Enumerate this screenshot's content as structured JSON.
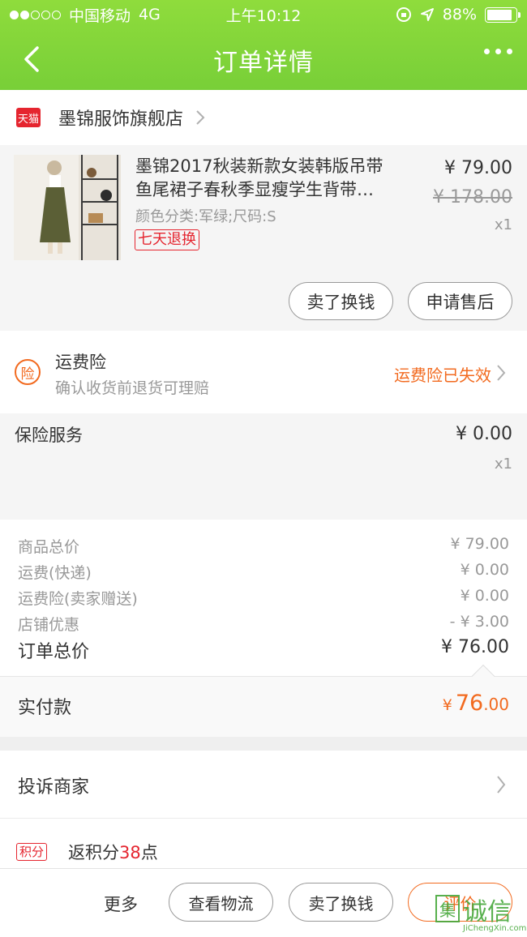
{
  "status_bar": {
    "carrier": "中国移动",
    "network": "4G",
    "time": "上午10:12",
    "battery": "88%",
    "battery_level": 0.88
  },
  "nav": {
    "title": "订单详情"
  },
  "store": {
    "badge": "天猫",
    "name": "墨锦服饰旗舰店"
  },
  "item": {
    "title_line1": "墨锦2017秋装新款女装韩版吊带",
    "title_line2": "鱼尾裙子春秋季显瘦学生背带…",
    "spec": "颜色分类:军绿;尺码:S",
    "tag": "七天退换",
    "price": "¥ 79.00",
    "original_price": "¥ 178.00",
    "quantity": "x1",
    "btn_sell": "卖了换钱",
    "btn_aftersale": "申请售后"
  },
  "insurance": {
    "icon_text": "险",
    "title": "运费险",
    "subtitle": "确认收货前退货可理赔",
    "status": "运费险已失效"
  },
  "service": {
    "title": "保险服务",
    "price": "¥ 0.00",
    "quantity": "x1"
  },
  "summary": {
    "rows": [
      {
        "label": "商品总价",
        "value": "¥ 79.00"
      },
      {
        "label": "运费(快递)",
        "value": "¥ 0.00"
      },
      {
        "label": "运费险(卖家赠送)",
        "value": "¥ 0.00"
      },
      {
        "label": "店铺优惠",
        "value": "- ¥ 3.00"
      }
    ],
    "total_label": "订单总价",
    "total_value": "¥ 76.00"
  },
  "payment": {
    "label": "实付款",
    "currency": "¥",
    "amount_int": "76",
    "amount_dec": ".00"
  },
  "complaint": {
    "label": "投诉商家"
  },
  "points": {
    "badge": "积分",
    "prefix": "返积分",
    "value": "38",
    "suffix": "点"
  },
  "bottom": {
    "more": "更多",
    "logistics": "查看物流",
    "sell": "卖了换钱",
    "review": "评价"
  },
  "watermark": {
    "char": "集",
    "text": "诚信",
    "url": "JiChengXin.com"
  },
  "colors": {
    "header_green": "#80d43a",
    "accent_orange": "#f26a1f",
    "tmall_red": "#e5252f"
  }
}
